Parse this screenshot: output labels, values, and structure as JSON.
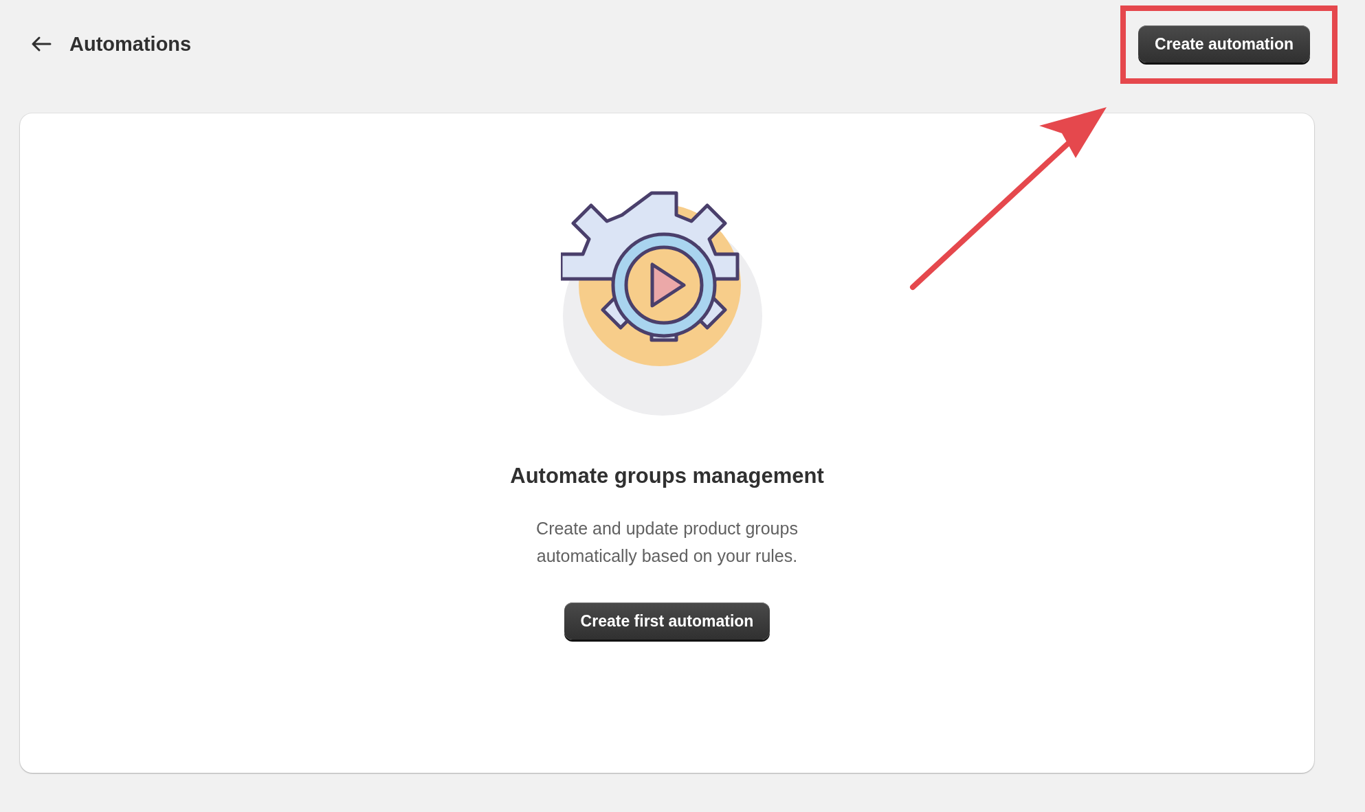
{
  "header": {
    "title": "Automations",
    "action": "Create automation"
  },
  "empty_state": {
    "heading": "Automate groups management",
    "description": "Create and update product groups automatically based on your rules.",
    "button": "Create first automation"
  }
}
